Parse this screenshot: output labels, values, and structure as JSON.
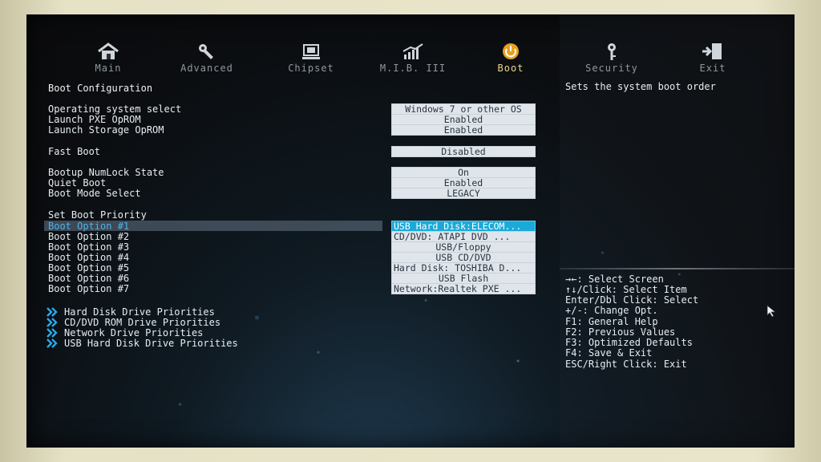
{
  "tabs": [
    {
      "label": "Main",
      "icon": "home-icon"
    },
    {
      "label": "Advanced",
      "icon": "wrench-icon"
    },
    {
      "label": "Chipset",
      "icon": "chipset-icon"
    },
    {
      "label": "M.I.B. III",
      "icon": "graph-icon"
    },
    {
      "label": "Boot",
      "icon": "power-icon"
    },
    {
      "label": "Security",
      "icon": "key-icon"
    },
    {
      "label": "Exit",
      "icon": "exit-door-icon"
    }
  ],
  "active_tab": "Boot",
  "boot": {
    "section_title": "Boot Configuration",
    "description": "Sets the system boot order",
    "settings": [
      {
        "label": "Operating system select",
        "value": "Windows 7 or other OS"
      },
      {
        "label": "Launch PXE OpROM",
        "value": "Enabled"
      },
      {
        "label": "Launch Storage OpROM",
        "value": "Enabled"
      },
      {
        "label": "Fast Boot",
        "value": "Disabled"
      },
      {
        "label": "Bootup NumLock State",
        "value": "On"
      },
      {
        "label": "Quiet Boot",
        "value": "Enabled"
      },
      {
        "label": "Boot Mode Select",
        "value": "LEGACY"
      }
    ],
    "priority_title": "Set Boot Priority",
    "options": [
      {
        "label": "Boot Option #1",
        "value": "USB Hard Disk:ELECOM..."
      },
      {
        "label": "Boot Option #2",
        "value": "CD/DVD: ATAPI   DVD ..."
      },
      {
        "label": "Boot Option #3",
        "value": "USB/Floppy"
      },
      {
        "label": "Boot Option #4",
        "value": "USB CD/DVD"
      },
      {
        "label": "Boot Option #5",
        "value": "Hard Disk: TOSHIBA D..."
      },
      {
        "label": "Boot Option #6",
        "value": "USB Flash"
      },
      {
        "label": "Boot Option #7",
        "value": "Network:Realtek PXE ..."
      }
    ],
    "submenus": [
      "Hard Disk Drive Priorities",
      "CD/DVD ROM Drive Priorities",
      "Network Drive Priorities",
      "USB Hard Disk Drive Priorities"
    ]
  },
  "help_keys": [
    "→←: Select Screen",
    "↑↓/Click: Select Item",
    "Enter/Dbl Click: Select",
    "+/-: Change Opt.",
    "F1: General Help",
    "F2: Previous Values",
    "F3: Optimized Defaults",
    "F4: Save & Exit",
    "ESC/Right Click: Exit"
  ],
  "colors": {
    "active_tab": "#f0d28a",
    "selection": "#1aaad8",
    "value_box": "#dfe5ea"
  }
}
